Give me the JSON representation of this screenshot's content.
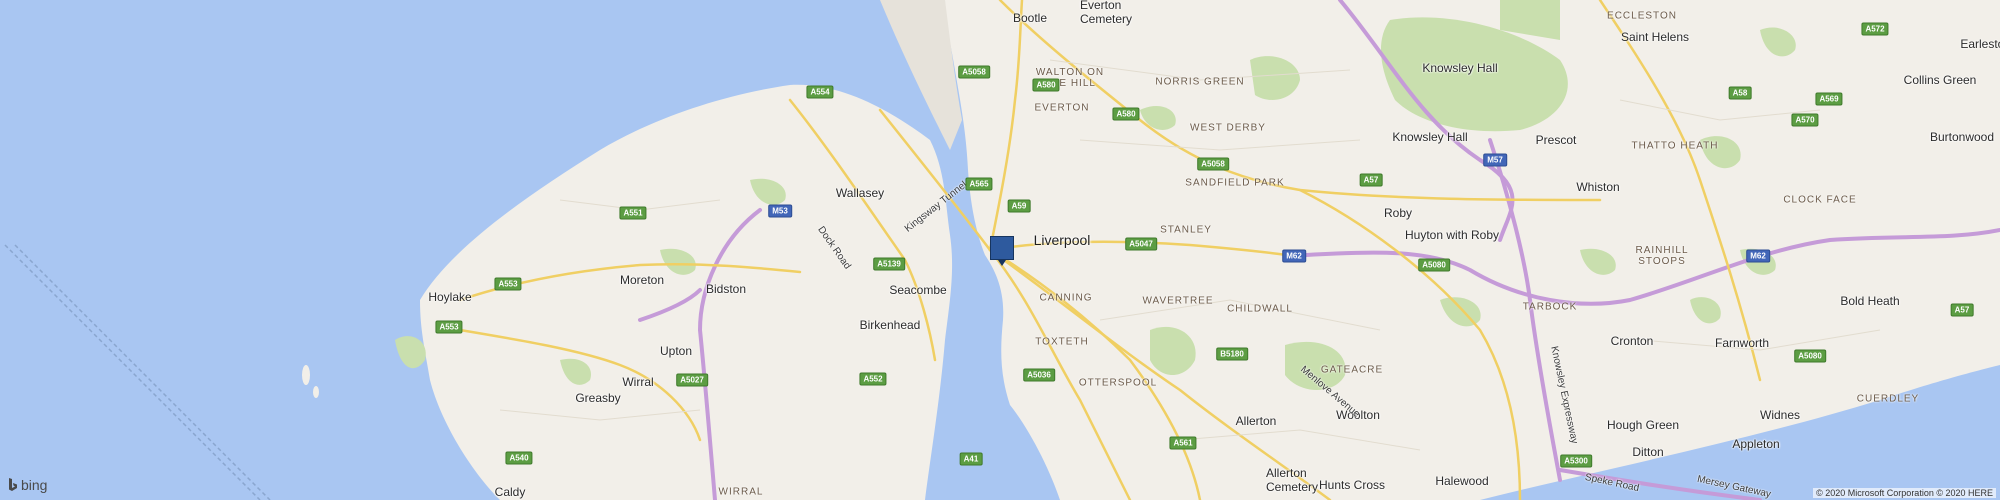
{
  "map": {
    "places": [
      {
        "name": "Bootle",
        "kind": "place"
      },
      {
        "name": "Everton\nCemetery",
        "kind": "place"
      },
      {
        "name": "ECCLESTON",
        "kind": "district"
      },
      {
        "name": "Saint Helens",
        "kind": "place"
      },
      {
        "name": "Earlestown",
        "kind": "place"
      },
      {
        "name": "Collins Green",
        "kind": "place"
      },
      {
        "name": "Knowsley Hall",
        "kind": "place"
      },
      {
        "name": "WALTON ON\nTHE HILL",
        "kind": "district"
      },
      {
        "name": "NORRIS GREEN",
        "kind": "district"
      },
      {
        "name": "WEST DERBY",
        "kind": "district"
      },
      {
        "name": "EVERTON",
        "kind": "district"
      },
      {
        "name": "Knowsley Hall",
        "kind": "place"
      },
      {
        "name": "Prescot",
        "kind": "place"
      },
      {
        "name": "THATTO HEATH",
        "kind": "district"
      },
      {
        "name": "Burtonwood",
        "kind": "place"
      },
      {
        "name": "Wallasey",
        "kind": "place"
      },
      {
        "name": "SANDFIELD PARK",
        "kind": "district"
      },
      {
        "name": "Whiston",
        "kind": "place"
      },
      {
        "name": "Roby",
        "kind": "place"
      },
      {
        "name": "CLOCK FACE",
        "kind": "district"
      },
      {
        "name": "Liverpool",
        "kind": "city"
      },
      {
        "name": "STANLEY",
        "kind": "district"
      },
      {
        "name": "Huyton with Roby",
        "kind": "place"
      },
      {
        "name": "RAINHILL\nSTOOPS",
        "kind": "district"
      },
      {
        "name": "Moreton",
        "kind": "place"
      },
      {
        "name": "Bidston",
        "kind": "place"
      },
      {
        "name": "Seacombe",
        "kind": "place"
      },
      {
        "name": "Hoylake",
        "kind": "place"
      },
      {
        "name": "CANNING",
        "kind": "district"
      },
      {
        "name": "WAVERTREE",
        "kind": "district"
      },
      {
        "name": "CHILDWALL",
        "kind": "district"
      },
      {
        "name": "TARBOCK",
        "kind": "district"
      },
      {
        "name": "Bold Heath",
        "kind": "place"
      },
      {
        "name": "Birkenhead",
        "kind": "place"
      },
      {
        "name": "Upton",
        "kind": "place"
      },
      {
        "name": "TOXTETH",
        "kind": "district"
      },
      {
        "name": "Cronton",
        "kind": "place"
      },
      {
        "name": "Farnworth",
        "kind": "place"
      },
      {
        "name": "Wirral",
        "kind": "place"
      },
      {
        "name": "GATEACRE",
        "kind": "district"
      },
      {
        "name": "Greasby",
        "kind": "place"
      },
      {
        "name": "OTTERSPOOL",
        "kind": "district"
      },
      {
        "name": "Woolton",
        "kind": "place"
      },
      {
        "name": "Allerton",
        "kind": "place"
      },
      {
        "name": "Hough Green",
        "kind": "place"
      },
      {
        "name": "Widnes",
        "kind": "place"
      },
      {
        "name": "CUERDLEY",
        "kind": "district"
      },
      {
        "name": "Ditton",
        "kind": "place"
      },
      {
        "name": "Appleton",
        "kind": "place"
      },
      {
        "name": "Allerton\nCemetery",
        "kind": "place"
      },
      {
        "name": "Hunts Cross",
        "kind": "place"
      },
      {
        "name": "Halewood",
        "kind": "place"
      },
      {
        "name": "Caldy",
        "kind": "place"
      },
      {
        "name": "WIRRAL",
        "kind": "district"
      }
    ],
    "roads": [
      {
        "name": "Kingsway Tunnel"
      },
      {
        "name": "Dock Road"
      },
      {
        "name": "Menlove Avenue"
      },
      {
        "name": "Knowsley Expressway"
      },
      {
        "name": "Speke Road"
      },
      {
        "name": "Mersey Gateway"
      }
    ],
    "shields": [
      {
        "ref": "A554",
        "type": "a"
      },
      {
        "ref": "A5058",
        "type": "a"
      },
      {
        "ref": "A580",
        "type": "a"
      },
      {
        "ref": "A580",
        "type": "a"
      },
      {
        "ref": "A5058",
        "type": "a"
      },
      {
        "ref": "A565",
        "type": "a"
      },
      {
        "ref": "A59",
        "type": "a"
      },
      {
        "ref": "A551",
        "type": "a"
      },
      {
        "ref": "M53",
        "type": "m"
      },
      {
        "ref": "A5047",
        "type": "a"
      },
      {
        "ref": "A57",
        "type": "a"
      },
      {
        "ref": "M57",
        "type": "m"
      },
      {
        "ref": "M62",
        "type": "m"
      },
      {
        "ref": "A5080",
        "type": "a"
      },
      {
        "ref": "A5139",
        "type": "a"
      },
      {
        "ref": "A553",
        "type": "a"
      },
      {
        "ref": "A553",
        "type": "a"
      },
      {
        "ref": "A5036",
        "type": "a"
      },
      {
        "ref": "B5180",
        "type": "a"
      },
      {
        "ref": "A5027",
        "type": "a"
      },
      {
        "ref": "A552",
        "type": "a"
      },
      {
        "ref": "A540",
        "type": "a"
      },
      {
        "ref": "A561",
        "type": "a"
      },
      {
        "ref": "A41",
        "type": "a"
      },
      {
        "ref": "A5300",
        "type": "a"
      },
      {
        "ref": "A572",
        "type": "a"
      },
      {
        "ref": "A58",
        "type": "a"
      },
      {
        "ref": "A569",
        "type": "a"
      },
      {
        "ref": "A570",
        "type": "a"
      },
      {
        "ref": "M62",
        "type": "m"
      },
      {
        "ref": "A57",
        "type": "a"
      },
      {
        "ref": "A5080",
        "type": "a"
      }
    ],
    "pushpin_label": "",
    "logo_text": "bing",
    "copyright": "© 2020 Microsoft Corporation © 2020 HERE",
    "colors": {
      "water": "#a9c6f2",
      "land": "#f2efe9",
      "park": "#c9dfae",
      "motorway": "#c59bd8",
      "major_road": "#f7e08c",
      "pushpin": "#2e5a9e"
    }
  }
}
